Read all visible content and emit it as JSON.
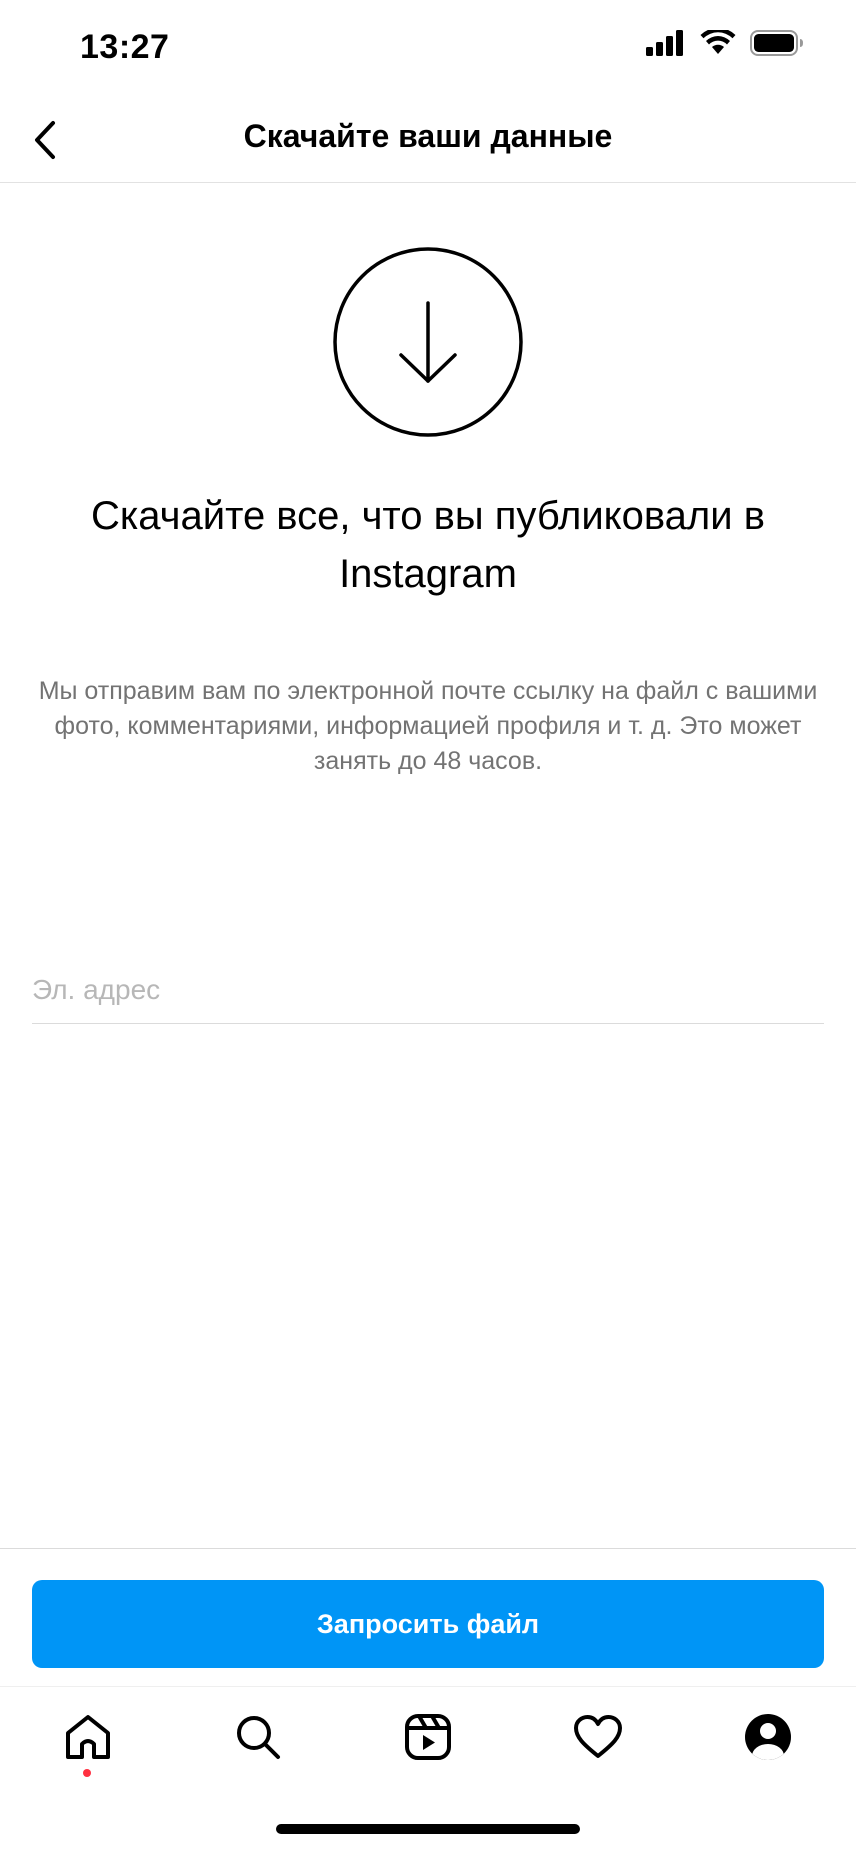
{
  "status_bar": {
    "time": "13:27",
    "icons": [
      "cellular-signal-icon",
      "wifi-icon",
      "battery-icon"
    ]
  },
  "header": {
    "title": "Скачайте ваши данные",
    "back_icon": "chevron-left-icon"
  },
  "hero": {
    "icon": "download-arrow-icon",
    "heading": "Скачайте все, что вы публиковали в Instagram",
    "description": "Мы отправим вам по электронной почте ссылку на файл с вашими фото, комментариями, информацией профиля и т. д. Это может занять до 48 часов."
  },
  "form": {
    "email_value": "",
    "email_placeholder": "Эл. адрес",
    "submit_label": "Запросить файл"
  },
  "tab_bar": {
    "items": [
      {
        "name": "home",
        "icon": "home-icon",
        "active": true
      },
      {
        "name": "search",
        "icon": "search-icon",
        "active": false
      },
      {
        "name": "reels",
        "icon": "reels-icon",
        "active": false
      },
      {
        "name": "activity",
        "icon": "heart-icon",
        "active": false
      },
      {
        "name": "profile",
        "icon": "profile-icon",
        "active": false
      }
    ]
  },
  "colors": {
    "accent": "#0095f6",
    "notification_dot": "#ff3040",
    "secondary_text": "#737373"
  }
}
